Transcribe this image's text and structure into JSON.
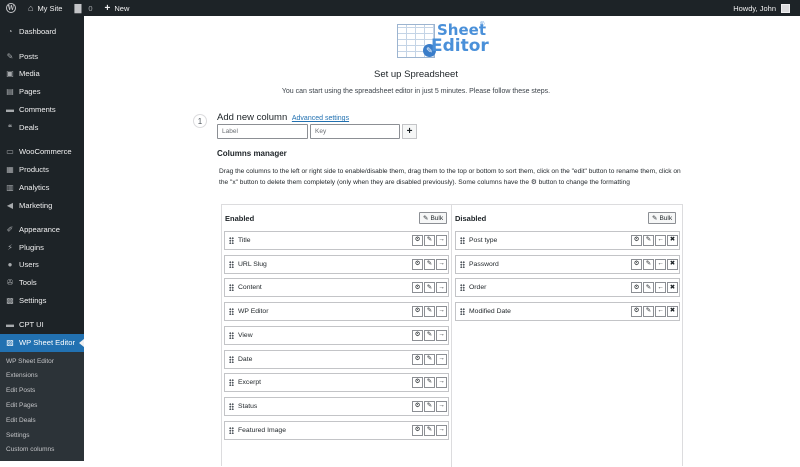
{
  "adminbar": {
    "site_name": "My Site",
    "comments_count": "0",
    "new_label": "New",
    "greeting": "Howdy, John"
  },
  "sidebar": {
    "items": [
      {
        "label": "Dashboard",
        "icon": "dashboard-icon"
      },
      {
        "label": "Posts",
        "icon": "pin-icon"
      },
      {
        "label": "Media",
        "icon": "media-icon"
      },
      {
        "label": "Pages",
        "icon": "pages-icon"
      },
      {
        "label": "Comments",
        "icon": "comment-icon"
      },
      {
        "label": "Deals",
        "icon": "deals-icon"
      },
      {
        "label": "WooCommerce",
        "icon": "woo-icon"
      },
      {
        "label": "Products",
        "icon": "products-icon"
      },
      {
        "label": "Analytics",
        "icon": "analytics-icon"
      },
      {
        "label": "Marketing",
        "icon": "megaphone-icon"
      },
      {
        "label": "Appearance",
        "icon": "brush-icon"
      },
      {
        "label": "Plugins",
        "icon": "plugin-icon"
      },
      {
        "label": "Users",
        "icon": "users-icon"
      },
      {
        "label": "Tools",
        "icon": "wrench-icon"
      },
      {
        "label": "Settings",
        "icon": "settings-icon"
      },
      {
        "label": "CPT UI",
        "icon": "cptui-icon"
      },
      {
        "label": "WP Sheet Editor",
        "icon": "sheet-editor-icon"
      }
    ],
    "submenu": [
      "WP Sheet Editor",
      "Extensions",
      "Edit Posts",
      "Edit Pages",
      "Edit Deals",
      "Settings",
      "Custom columns"
    ]
  },
  "logo": {
    "line1": "Sheet",
    "line2": "Editor",
    "reg": "®"
  },
  "page": {
    "title": "Set up Spreadsheet",
    "subtitle": "You can start using the spreadsheet editor in just 5 minutes. Please follow these steps."
  },
  "add_column": {
    "step": "1",
    "title": "Add new column",
    "advanced_link": "Advanced settings",
    "label_placeholder": "Label",
    "key_placeholder": "Key",
    "add_button": "+"
  },
  "columns_manager": {
    "title": "Columns manager",
    "description_part1": "Drag the columns to the left or right side to enable/disable them, drag them to the top or bottom to sort them, click on the \"edit\" button to rename them, click on the \"x\" button to delete them completely (only when they are disabled previously). Some columns have the",
    "description_part2": "button to change the formatting",
    "enabled_title": "Enabled",
    "disabled_title": "Disabled",
    "bulk_label": "Bulk",
    "enabled": [
      "Title",
      "URL Slug",
      "Content",
      "WP Editor",
      "View",
      "Date",
      "Excerpt",
      "Status",
      "Featured Image"
    ],
    "disabled": [
      "Post type",
      "Password",
      "Order",
      "Modified Date"
    ]
  },
  "colors": {
    "admin_bg": "#1d2327",
    "accent": "#2271b1",
    "submenu_bg": "#2c3338",
    "logo_blue": "#4a90d9"
  }
}
